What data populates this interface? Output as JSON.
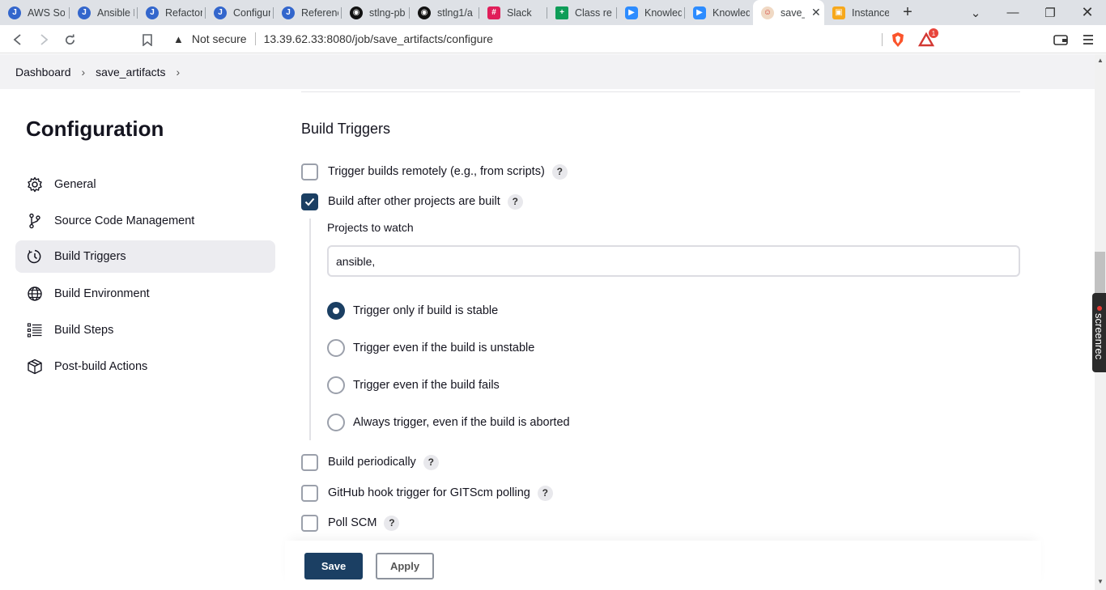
{
  "browser": {
    "tabs": [
      {
        "label": "AWS Solu",
        "icon": "jenkins-icon",
        "color": "#3366cc"
      },
      {
        "label": "Ansible P",
        "icon": "jenkins-icon",
        "color": "#3366cc"
      },
      {
        "label": "Refactor",
        "icon": "jenkins-icon",
        "color": "#3366cc"
      },
      {
        "label": "Configur",
        "icon": "jenkins-icon",
        "color": "#3366cc"
      },
      {
        "label": "Referenc",
        "icon": "jenkins-icon",
        "color": "#3366cc"
      },
      {
        "label": "stlng-pb",
        "icon": "github-icon",
        "color": "#111111"
      },
      {
        "label": "stlng1/a",
        "icon": "github-icon",
        "color": "#111111"
      },
      {
        "label": "Slack",
        "icon": "slack-icon",
        "color": "#e01e5a"
      },
      {
        "label": "Class rec",
        "icon": "sheets-icon",
        "color": "#0f9d58"
      },
      {
        "label": "Knowled",
        "icon": "zoom-icon",
        "color": "#2d8cff"
      },
      {
        "label": "Knowled",
        "icon": "zoom-icon",
        "color": "#2d8cff"
      },
      {
        "label": "save_",
        "icon": "jenkins-butler-icon",
        "color": "#d33833"
      },
      {
        "label": "Instance",
        "icon": "aws-box-icon",
        "color": "#f7a81b"
      }
    ],
    "address": {
      "security_label": "Not secure",
      "url": "13.39.62.33:8080/job/save_artifacts/configure"
    },
    "notification_count": "1"
  },
  "breadcrumb": {
    "items": [
      "Dashboard",
      "save_artifacts"
    ]
  },
  "sidebar": {
    "title": "Configuration",
    "items": [
      {
        "label": "General",
        "icon": "gear-icon"
      },
      {
        "label": "Source Code Management",
        "icon": "branch-icon"
      },
      {
        "label": "Build Triggers",
        "icon": "clock-icon"
      },
      {
        "label": "Build Environment",
        "icon": "globe-icon"
      },
      {
        "label": "Build Steps",
        "icon": "list-icon"
      },
      {
        "label": "Post-build Actions",
        "icon": "package-icon"
      }
    ],
    "active_index": 2
  },
  "main": {
    "section_title": "Build Triggers",
    "triggers": [
      {
        "label": "Trigger builds remotely (e.g., from scripts)",
        "checked": false,
        "help": "?"
      },
      {
        "label": "Build after other projects are built",
        "checked": true,
        "help": "?"
      },
      {
        "label": "Build periodically",
        "checked": false,
        "help": "?"
      },
      {
        "label": "GitHub hook trigger for GITScm polling",
        "checked": false,
        "help": "?"
      },
      {
        "label": "Poll SCM",
        "checked": false,
        "help": "?"
      }
    ],
    "projects_to_watch": {
      "label": "Projects to watch",
      "value": "ansible,"
    },
    "radio_options": [
      {
        "label": "Trigger only if build is stable",
        "selected": true
      },
      {
        "label": "Trigger even if the build is unstable",
        "selected": false
      },
      {
        "label": "Trigger even if the build fails",
        "selected": false
      },
      {
        "label": "Always trigger, even if the build is aborted",
        "selected": false
      }
    ]
  },
  "buttons": {
    "save": "Save",
    "apply": "Apply"
  },
  "overlay": {
    "screenrec_label": "screenrec"
  },
  "colors": {
    "accent": "#1b3f63",
    "sidebar_active": "#ececf0"
  }
}
